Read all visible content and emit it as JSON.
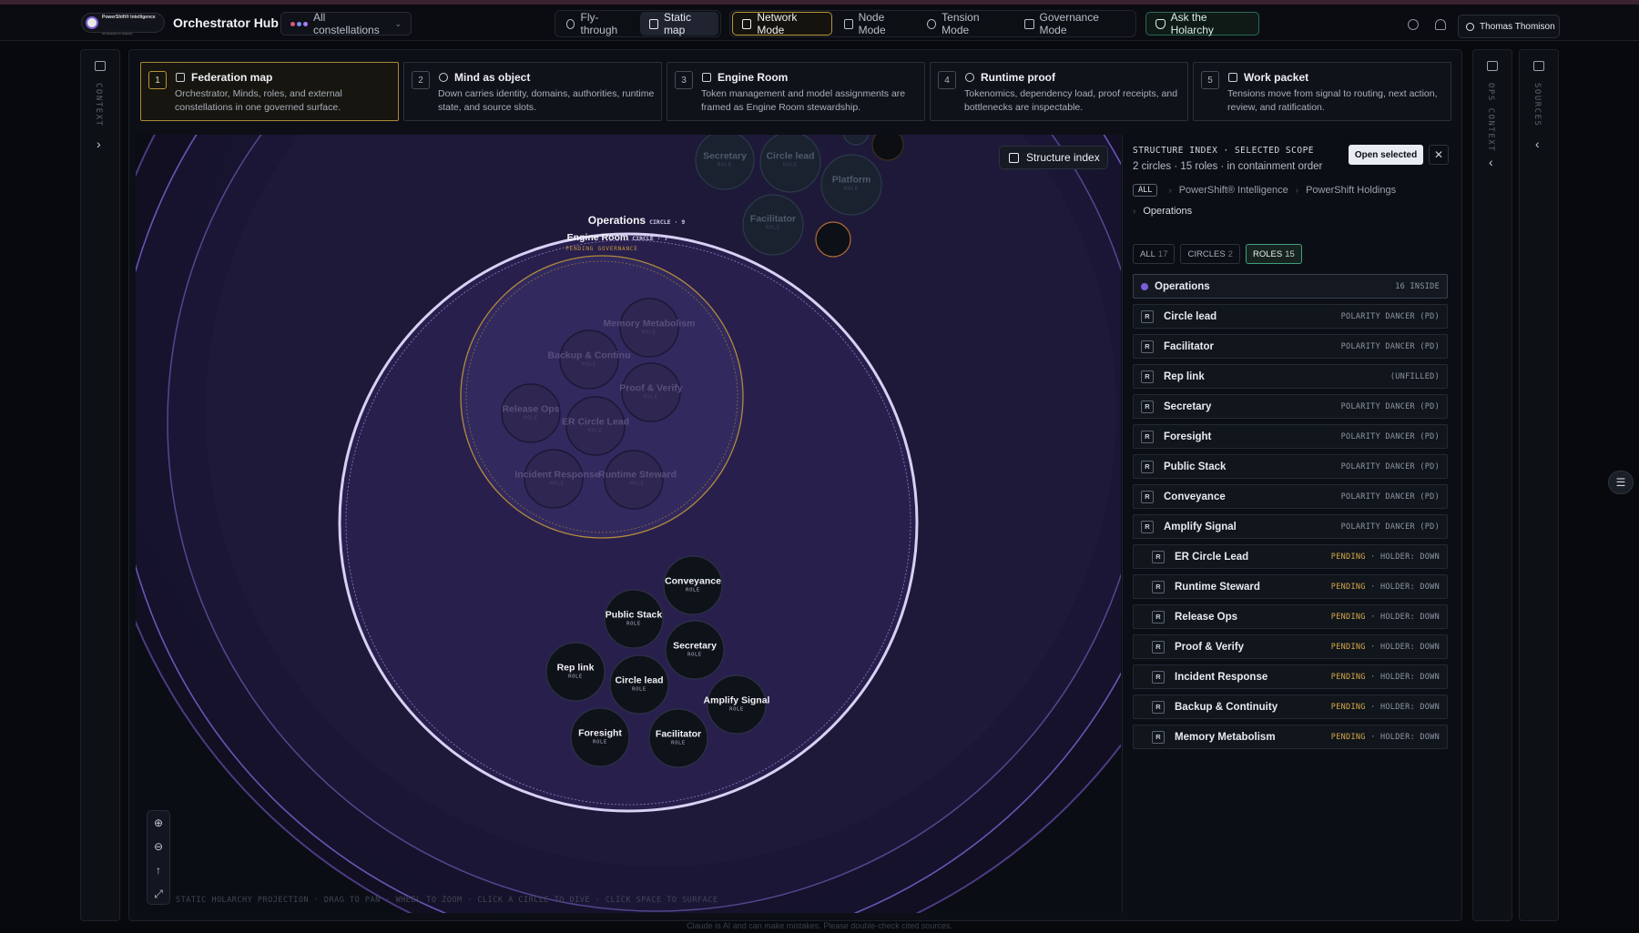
{
  "header": {
    "logo_text": "PowerShift® Intelligence",
    "logo_subtext": "Orchestrator for Holarchy",
    "app_title": "Orchestrator Hub",
    "constellation_select": "All constellations",
    "views": [
      "Fly-through",
      "Static map"
    ],
    "active_view": "Static map",
    "modes": [
      "Network Mode",
      "Node Mode",
      "Tension Mode",
      "Governance Mode"
    ],
    "active_mode": "Network Mode",
    "ask_label": "Ask the Holarchy",
    "user_name": "Thomas Thomison"
  },
  "left_rail": {
    "label": "CONTEXT"
  },
  "right_rails": {
    "ops_label": "OPS CONTEXT",
    "sources_label": "SOURCES"
  },
  "steps": [
    {
      "num": "1",
      "title": "Federation map",
      "desc": "Orchestrator, Minds, roles, and external constellations in one governed surface.",
      "icon": "network-icon",
      "selected": true
    },
    {
      "num": "2",
      "title": "Mind as object",
      "desc": "Down carries identity, domains, authorities, runtime state, and source slots.",
      "icon": "sparkle-icon",
      "selected": false
    },
    {
      "num": "3",
      "title": "Engine Room",
      "desc": "Token management and model assignments are framed as Engine Room stewardship.",
      "icon": "layers-icon",
      "selected": false
    },
    {
      "num": "4",
      "title": "Runtime proof",
      "desc": "Tokenomics, dependency load, proof receipts, and bottlenecks are inspectable.",
      "icon": "broadcast-icon",
      "selected": false
    },
    {
      "num": "5",
      "title": "Work packet",
      "desc": "Tensions move from signal to routing, next action, review, and ratification.",
      "icon": "flow-icon",
      "selected": false
    }
  ],
  "canvas": {
    "structure_button": "Structure index",
    "hint": "STATIC HOLARCHY PROJECTION · DRAG TO PAN · WHEEL TO ZOOM · CLICK A CIRCLE TO DIVE · CLICK SPACE TO SURFACE",
    "operations": {
      "name": "Operations",
      "tag": "CIRCLE · 9"
    },
    "engine_room": {
      "name": "Engine Room",
      "tag": "CIRCLE · 7",
      "status": "PENDING GOVERNANCE"
    },
    "role_tag": "ROLE",
    "top_roles": [
      "Secretary",
      "Circle lead",
      "Platform",
      "Facilitator"
    ],
    "engine_roles": [
      "Memory Metabolism",
      "Backup & Continu",
      "Proof & Verify",
      "Release Ops",
      "ER Circle Lead",
      "Incident Response",
      "Runtime Steward"
    ],
    "ops_roles": [
      "Conveyance",
      "Public Stack",
      "Secretary",
      "Rep link",
      "Circle lead",
      "Amplify Signal",
      "Foresight",
      "Facilitator"
    ],
    "colors": {
      "circle_fill": "#2a2050",
      "circle_stroke": "#cfc6ee",
      "engine_stroke": "#b18a3a",
      "role_fill": "#0d1118",
      "accent": "#7a5ee0"
    }
  },
  "panel": {
    "heading": "STRUCTURE INDEX · SELECTED SCOPE",
    "subheading": "2 circles · 15 roles · in containment order",
    "open_label": "Open selected",
    "crumb_all": "ALL",
    "crumbs": [
      "PowerShift® Intelligence",
      "PowerShift Holdings",
      "Operations"
    ],
    "filters": [
      {
        "label": "ALL",
        "count": "17",
        "on": false
      },
      {
        "label": "CIRCLES",
        "count": "2",
        "on": false
      },
      {
        "label": "ROLES",
        "count": "15",
        "on": true
      }
    ],
    "head_row": {
      "name": "Operations",
      "meta": "16 INSIDE"
    },
    "rows": [
      {
        "name": "Circle lead",
        "meta": "POLARITY DANCER (PD)"
      },
      {
        "name": "Facilitator",
        "meta": "POLARITY DANCER (PD)"
      },
      {
        "name": "Rep link",
        "meta": "(UNFILLED)"
      },
      {
        "name": "Secretary",
        "meta": "POLARITY DANCER (PD)"
      },
      {
        "name": "Foresight",
        "meta": "POLARITY DANCER (PD)"
      },
      {
        "name": "Public Stack",
        "meta": "POLARITY DANCER (PD)"
      },
      {
        "name": "Conveyance",
        "meta": "POLARITY DANCER (PD)"
      },
      {
        "name": "Amplify Signal",
        "meta": "POLARITY DANCER (PD)"
      }
    ],
    "pending_rows": [
      {
        "name": "ER Circle Lead",
        "status": "PENDING",
        "meta": "· HOLDER: DOWN"
      },
      {
        "name": "Runtime Steward",
        "status": "PENDING",
        "meta": "· HOLDER: DOWN"
      },
      {
        "name": "Release Ops",
        "status": "PENDING",
        "meta": "· HOLDER: DOWN"
      },
      {
        "name": "Proof & Verify",
        "status": "PENDING",
        "meta": "· HOLDER: DOWN"
      },
      {
        "name": "Incident Response",
        "status": "PENDING",
        "meta": "· HOLDER: DOWN"
      },
      {
        "name": "Backup & Continuity",
        "status": "PENDING",
        "meta": "· HOLDER: DOWN"
      },
      {
        "name": "Memory Metabolism",
        "status": "PENDING",
        "meta": "· HOLDER: DOWN"
      }
    ]
  },
  "footer": {
    "disclaimer": "Claude is AI and can make mistakes. Please double-check cited sources."
  }
}
